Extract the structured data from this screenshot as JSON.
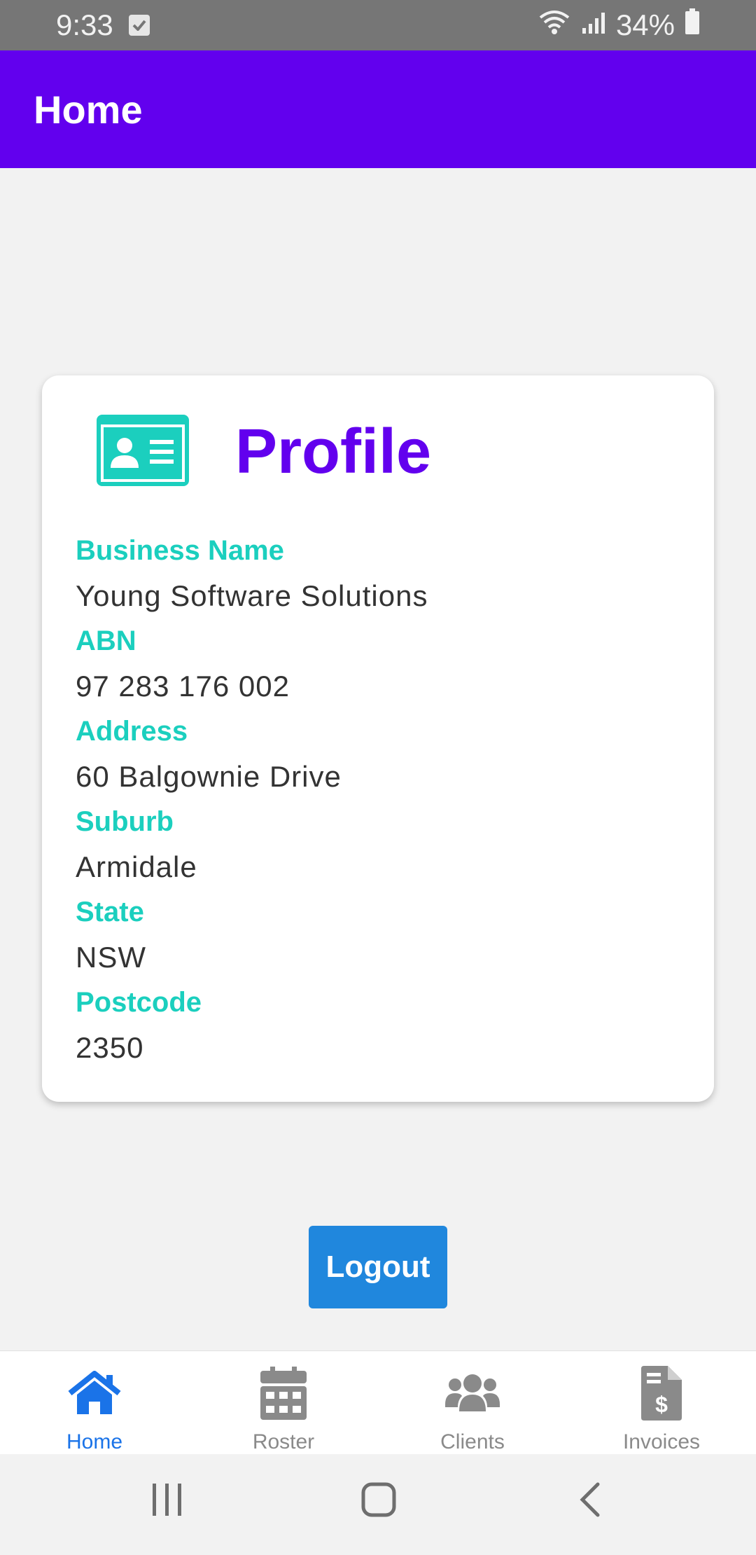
{
  "status_bar": {
    "time": "9:33",
    "battery": "34%",
    "icons": [
      "checkbox-notification-icon",
      "wifi-icon",
      "signal-icon",
      "battery-icon"
    ]
  },
  "app_bar": {
    "title": "Home"
  },
  "profile": {
    "title": "Profile",
    "icon": "id-card-icon",
    "fields": [
      {
        "label": "Business Name",
        "value": "Young Software Solutions"
      },
      {
        "label": "ABN",
        "value": "97 283 176 002"
      },
      {
        "label": "Address",
        "value": "60 Balgownie Drive"
      },
      {
        "label": "Suburb",
        "value": "Armidale"
      },
      {
        "label": "State",
        "value": "NSW"
      },
      {
        "label": "Postcode",
        "value": "2350"
      }
    ]
  },
  "logout_label": "Logout",
  "bottom_nav": {
    "items": [
      {
        "label": "Home",
        "icon": "home-icon",
        "active": true
      },
      {
        "label": "Roster",
        "icon": "calendar-icon",
        "active": false
      },
      {
        "label": "Clients",
        "icon": "users-icon",
        "active": false
      },
      {
        "label": "Invoices",
        "icon": "invoice-icon",
        "active": false
      }
    ]
  },
  "colors": {
    "primary": "#6200ee",
    "accent": "#1bcfbe",
    "button": "#2087dd",
    "nav_active": "#1a73e8",
    "nav_inactive": "#8a8a8a"
  }
}
